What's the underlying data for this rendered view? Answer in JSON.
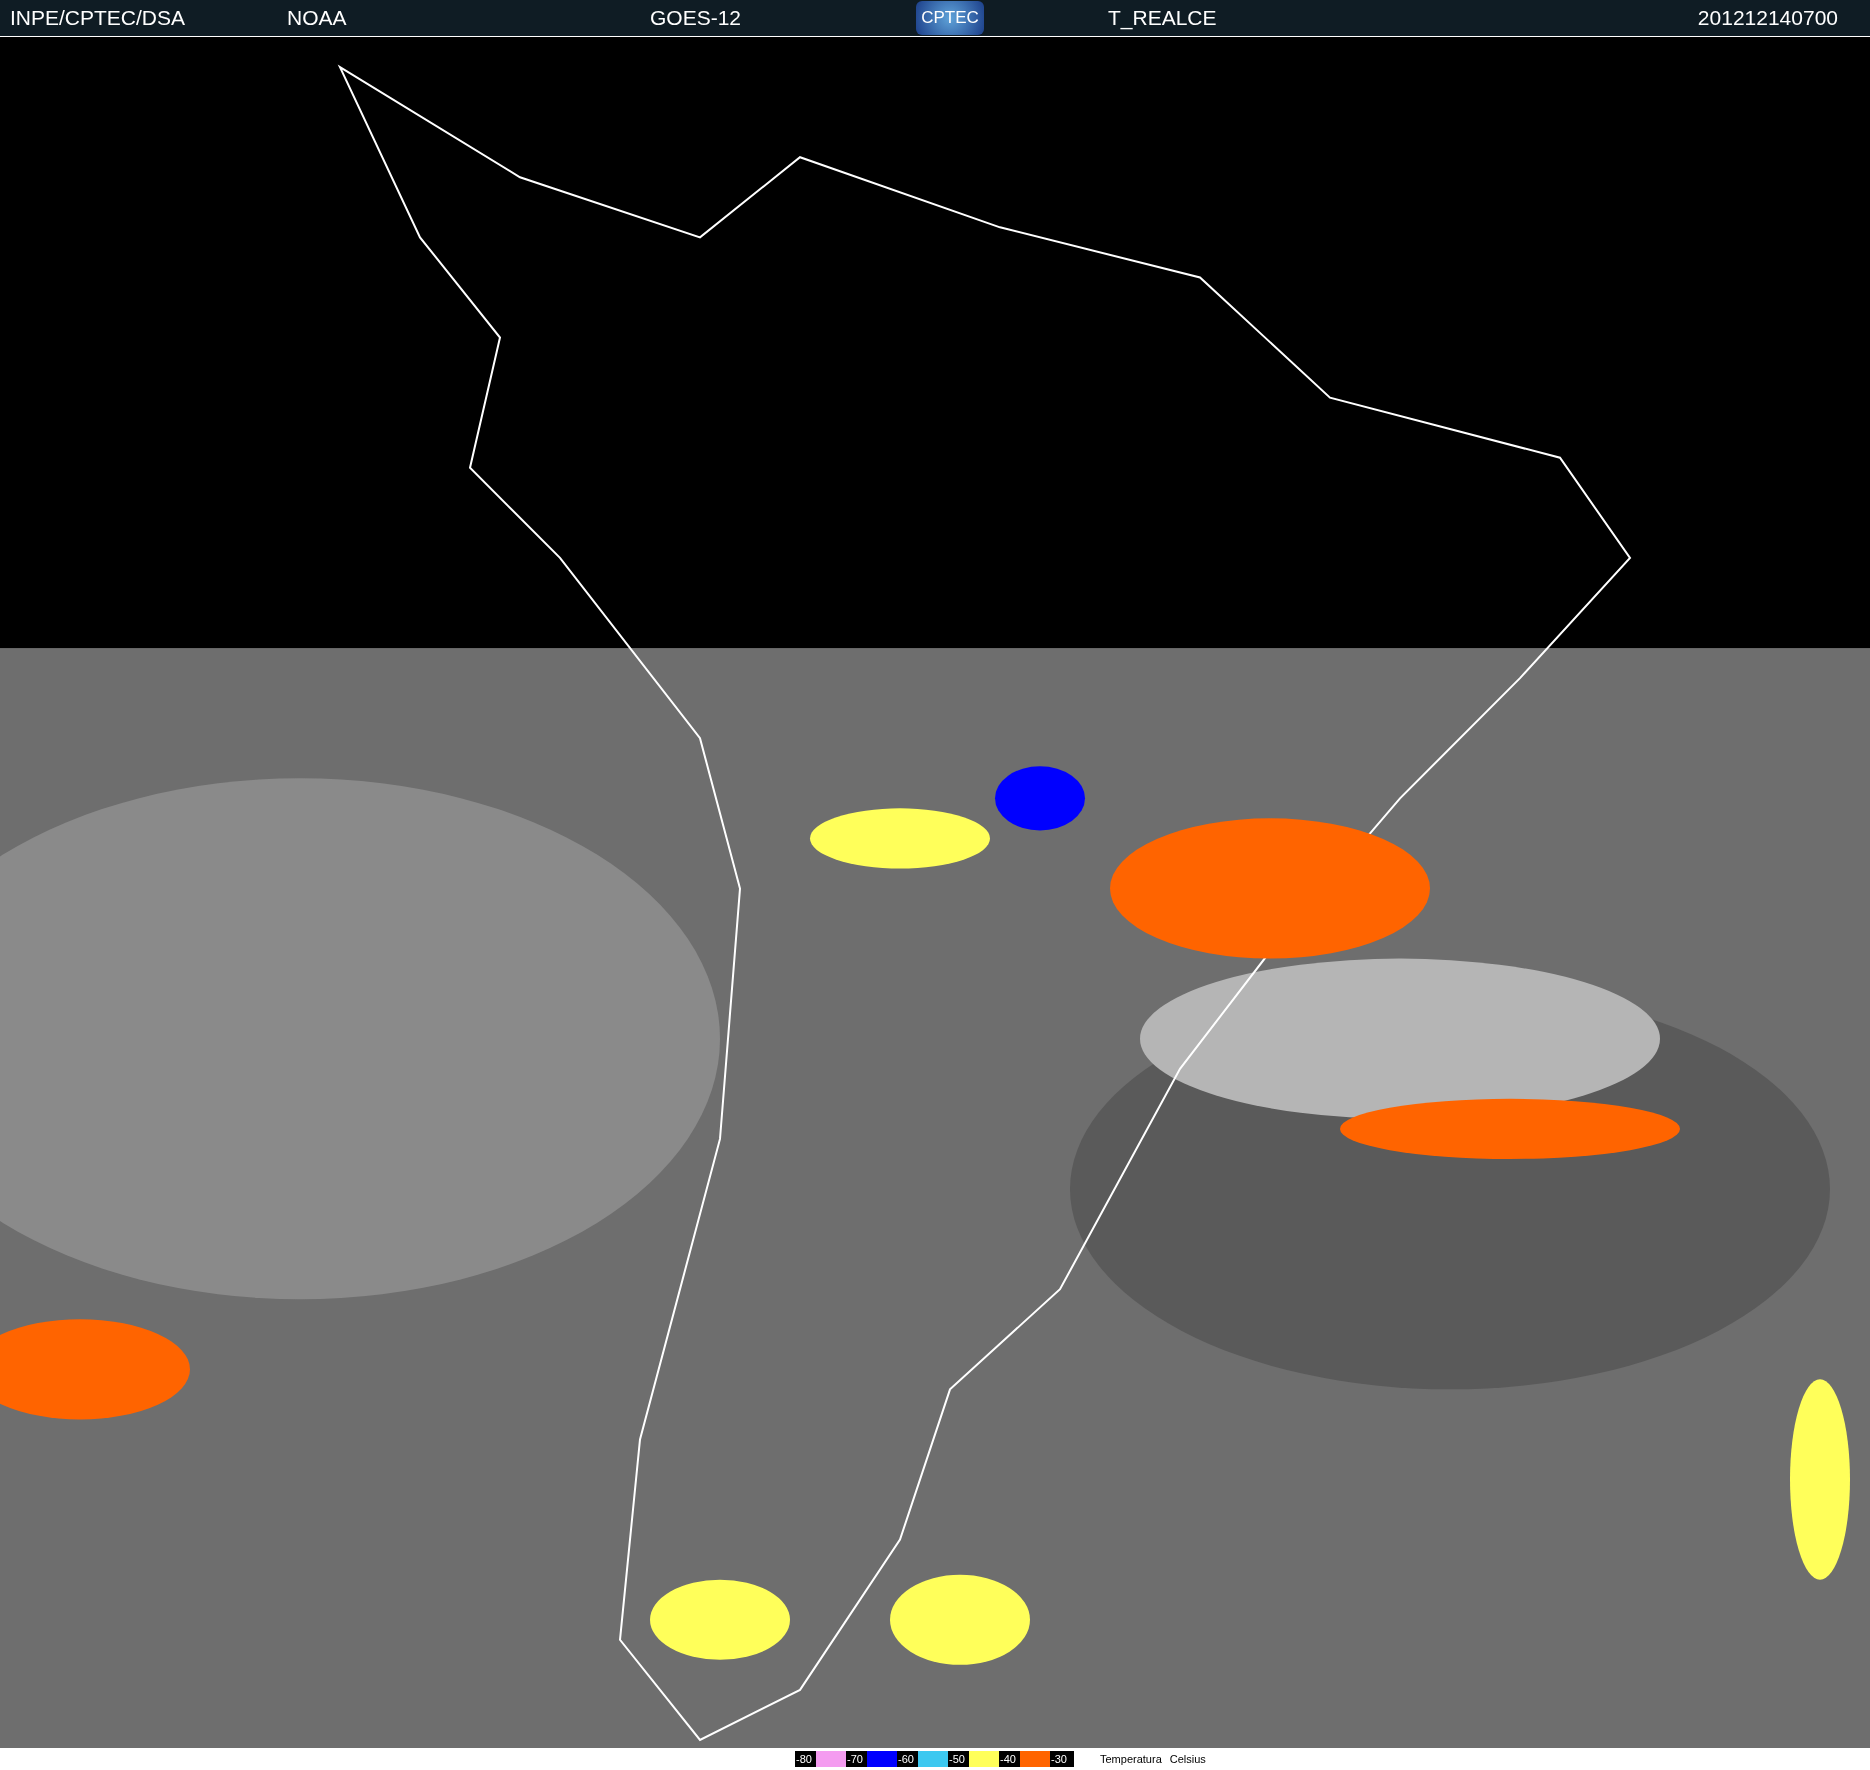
{
  "header": {
    "source": "INPE/CPTEC/DSA",
    "agency": "NOAA",
    "satellite": "GOES-12",
    "logo": "CPTEC",
    "product": "T_REALCE",
    "timestamp": "201212140700"
  },
  "legend": {
    "steps": [
      {
        "label": "-80",
        "color": "#f49cf0"
      },
      {
        "label": "-70",
        "color": "#0000ff"
      },
      {
        "label": "-60",
        "color": "#3cc8f0"
      },
      {
        "label": "-50",
        "color": "#ffff5a"
      },
      {
        "label": "-40",
        "color": "#ff6400"
      }
    ],
    "end_label": "-30",
    "title": "Temperatura",
    "unit": "Celsius"
  }
}
